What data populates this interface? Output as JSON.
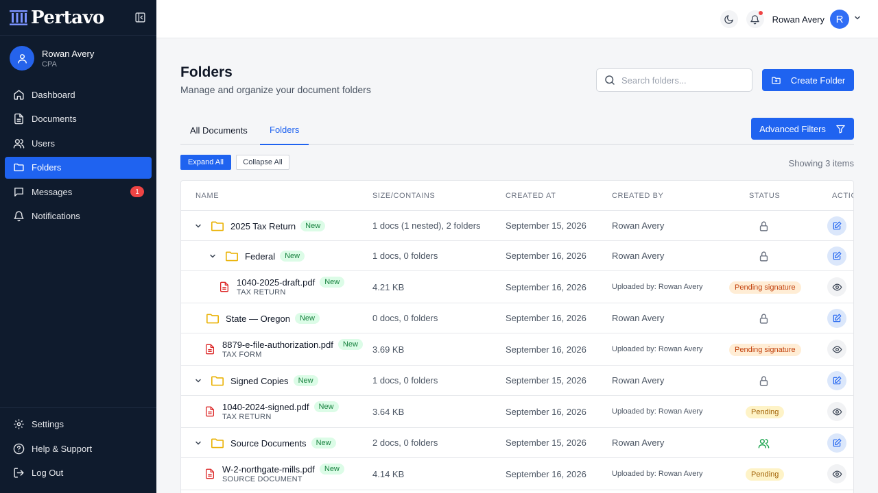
{
  "app": {
    "brand": "Pertavo"
  },
  "sidebar": {
    "profile": {
      "name": "Rowan Avery",
      "role": "CPA"
    },
    "nav": [
      {
        "label": "Dashboard",
        "icon": "home-icon"
      },
      {
        "label": "Documents",
        "icon": "document-icon"
      },
      {
        "label": "Users",
        "icon": "users-icon"
      },
      {
        "label": "Folders",
        "icon": "folder-icon",
        "active": true
      },
      {
        "label": "Messages",
        "icon": "message-icon",
        "badge": "1"
      },
      {
        "label": "Notifications",
        "icon": "bell-icon"
      }
    ],
    "bottom": [
      {
        "label": "Settings",
        "icon": "gear-icon"
      },
      {
        "label": "Help & Support",
        "icon": "help-icon"
      },
      {
        "label": "Log Out",
        "icon": "logout-icon"
      }
    ]
  },
  "topbar": {
    "user_name": "Rowan Avery",
    "avatar_initial": "R"
  },
  "page": {
    "title": "Folders",
    "subtitle": "Manage and organize your document folders",
    "search_placeholder": "Search folders...",
    "create_label": "Create Folder",
    "tabs": [
      "All Documents",
      "Folders"
    ],
    "active_tab": "Folders",
    "advanced_filters_label": "Advanced Filters",
    "expand_all_label": "Expand All",
    "collapse_all_label": "Collapse All",
    "showing_text": "Showing 3 items"
  },
  "table": {
    "headers": [
      "NAME",
      "SIZE/CONTAINS",
      "CREATED AT",
      "CREATED BY",
      "STATUS",
      "ACTIONS"
    ],
    "rows": [
      {
        "kind": "folder",
        "name": "2025 Tax Return",
        "badge": "New",
        "contains": "1 docs (1 nested), 2 folders",
        "created_at": "September 15, 2026",
        "created_by": "Rowan Avery",
        "status_icon": "lock-icon"
      },
      {
        "kind": "folder",
        "name": "Federal",
        "badge": "New",
        "contains": "1 docs, 0 folders",
        "created_at": "September 16, 2026",
        "created_by": "Rowan Avery",
        "status_icon": "lock-icon"
      },
      {
        "kind": "file",
        "name": "1040-2025-draft.pdf",
        "badge": "New",
        "type": "TAX RETURN",
        "contains": "4.21 KB",
        "created_at": "September 16, 2026",
        "created_by": "Uploaded by: Rowan Avery",
        "status": "Pending signature"
      },
      {
        "kind": "folder",
        "name": "State — Oregon",
        "badge": "New",
        "contains": "0 docs, 0 folders",
        "created_at": "September 16, 2026",
        "created_by": "Rowan Avery",
        "status_icon": "lock-icon"
      },
      {
        "kind": "file",
        "name": "8879-e-file-authorization.pdf",
        "badge": "New",
        "type": "TAX FORM",
        "contains": "3.69 KB",
        "created_at": "September 16, 2026",
        "created_by": "Uploaded by: Rowan Avery",
        "status": "Pending signature"
      },
      {
        "kind": "folder",
        "name": "Signed Copies",
        "badge": "New",
        "contains": "1 docs, 0 folders",
        "created_at": "September 15, 2026",
        "created_by": "Rowan Avery",
        "status_icon": "lock-icon"
      },
      {
        "kind": "file",
        "name": "1040-2024-signed.pdf",
        "badge": "New",
        "type": "TAX RETURN",
        "contains": "3.64 KB",
        "created_at": "September 16, 2026",
        "created_by": "Uploaded by: Rowan Avery",
        "status": "Pending"
      },
      {
        "kind": "folder",
        "name": "Source Documents",
        "badge": "New",
        "contains": "2 docs, 0 folders",
        "created_at": "September 15, 2026",
        "created_by": "Rowan Avery",
        "status_icon": "shared-users-icon"
      },
      {
        "kind": "file",
        "name": "W-2-northgate-mills.pdf",
        "badge": "New",
        "type": "SOURCE DOCUMENT",
        "contains": "4.14 KB",
        "created_at": "September 16, 2026",
        "created_by": "Uploaded by: Rowan Avery",
        "status": "Pending"
      }
    ]
  }
}
